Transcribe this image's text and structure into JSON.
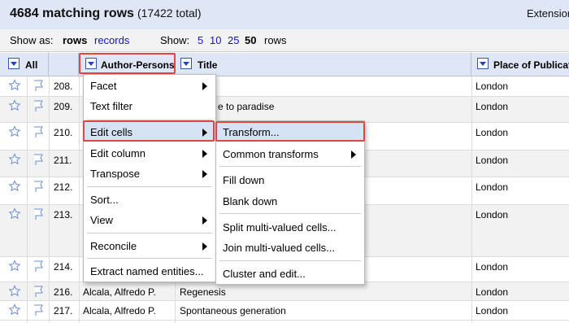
{
  "header": {
    "matching": "4684 matching rows",
    "total": "(17422 total)",
    "extensions": "Extensions"
  },
  "show_as": {
    "label": "Show as:",
    "rows": "rows",
    "records": "records",
    "show_label": "Show:",
    "sizes": [
      "5",
      "10",
      "25",
      "50"
    ],
    "rows_suffix": "rows"
  },
  "columns": {
    "all": "All",
    "author": "Author-Persons",
    "title": "Title",
    "place": "Place of Publication"
  },
  "rows": [
    {
      "num": "208.",
      "author": "",
      "title": "",
      "place": "London"
    },
    {
      "num": "209.",
      "author": "",
      "title": "e to paradise",
      "place": "London"
    },
    {
      "num": "210.",
      "author": "",
      "title": "",
      "place": "London"
    },
    {
      "num": "211.",
      "author": "",
      "title": "",
      "place": "London"
    },
    {
      "num": "212.",
      "author": "",
      "title": "",
      "place": "London"
    },
    {
      "num": "213.",
      "author": "",
      "title": "",
      "place": "London"
    },
    {
      "num": "214.",
      "author": "",
      "title": "",
      "place": "London"
    },
    {
      "num": "216.",
      "author": "Alcala, Alfredo P.",
      "title": "Regenesis",
      "place": "London"
    },
    {
      "num": "217.",
      "author": "Alcala, Alfredo P.",
      "title": "Spontaneous generation",
      "place": "London"
    }
  ],
  "column_menu": {
    "facet": "Facet",
    "text_filter": "Text filter",
    "edit_cells": "Edit cells",
    "edit_column": "Edit column",
    "transpose": "Transpose",
    "sort": "Sort...",
    "view": "View",
    "reconcile": "Reconcile",
    "extract": "Extract named entities..."
  },
  "edit_cells_menu": {
    "transform": "Transform...",
    "common": "Common transforms",
    "fill_down": "Fill down",
    "blank_down": "Blank down",
    "split": "Split multi-valued cells...",
    "join": "Join multi-valued cells...",
    "cluster": "Cluster and edit..."
  }
}
